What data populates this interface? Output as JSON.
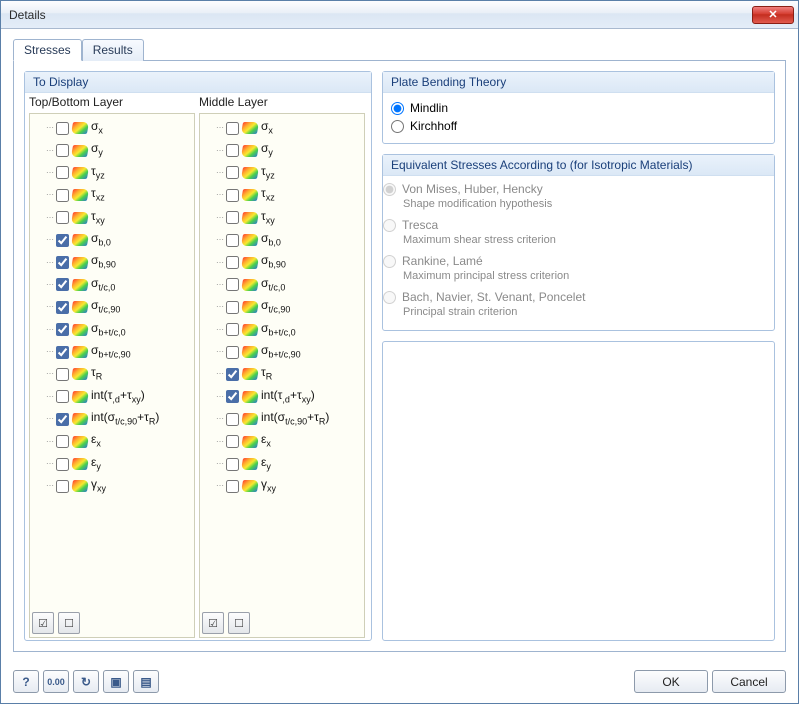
{
  "window": {
    "title": "Details"
  },
  "tabs": {
    "stresses": "Stresses",
    "results": "Results",
    "active": "stresses"
  },
  "display": {
    "group_title": "To Display",
    "col1_header": "Top/Bottom Layer",
    "col2_header": "Middle Layer",
    "top_bottom_items": [
      {
        "label": "σ<sub class='sub'>x</sub>",
        "checked": false
      },
      {
        "label": "σ<sub class='sub'>y</sub>",
        "checked": false
      },
      {
        "label": "τ<sub class='sub'>yz</sub>",
        "checked": false
      },
      {
        "label": "τ<sub class='sub'>xz</sub>",
        "checked": false
      },
      {
        "label": "τ<sub class='sub'>xy</sub>",
        "checked": false
      },
      {
        "label": "σ<sub class='sub'>b,0</sub>",
        "checked": true
      },
      {
        "label": "σ<sub class='sub'>b,90</sub>",
        "checked": true
      },
      {
        "label": "σ<sub class='sub'>t/c,0</sub>",
        "checked": true
      },
      {
        "label": "σ<sub class='sub'>t/c,90</sub>",
        "checked": true
      },
      {
        "label": "σ<sub class='sub'>b+t/c,0</sub>",
        "checked": true
      },
      {
        "label": "σ<sub class='sub'>b+t/c,90</sub>",
        "checked": true
      },
      {
        "label": "τ<sub class='sub'>R</sub>",
        "checked": false
      },
      {
        "label": "int(τ<sub class='sub'>,d</sub>+τ<sub class='sub'>xy</sub>)",
        "checked": false
      },
      {
        "label": "int(σ<sub class='sub'>t/c,90</sub>+τ<sub class='sub'>R</sub>)",
        "checked": true
      },
      {
        "label": "ε<sub class='sub'>x</sub>",
        "checked": false
      },
      {
        "label": "ε<sub class='sub'>y</sub>",
        "checked": false
      },
      {
        "label": "γ<sub class='sub'>xy</sub>",
        "checked": false
      }
    ],
    "middle_items": [
      {
        "label": "σ<sub class='sub'>x</sub>",
        "checked": false
      },
      {
        "label": "σ<sub class='sub'>y</sub>",
        "checked": false
      },
      {
        "label": "τ<sub class='sub'>yz</sub>",
        "checked": false
      },
      {
        "label": "τ<sub class='sub'>xz</sub>",
        "checked": false
      },
      {
        "label": "τ<sub class='sub'>xy</sub>",
        "checked": false
      },
      {
        "label": "σ<sub class='sub'>b,0</sub>",
        "checked": false
      },
      {
        "label": "σ<sub class='sub'>b,90</sub>",
        "checked": false
      },
      {
        "label": "σ<sub class='sub'>t/c,0</sub>",
        "checked": false
      },
      {
        "label": "σ<sub class='sub'>t/c,90</sub>",
        "checked": false
      },
      {
        "label": "σ<sub class='sub'>b+t/c,0</sub>",
        "checked": false
      },
      {
        "label": "σ<sub class='sub'>b+t/c,90</sub>",
        "checked": false
      },
      {
        "label": "τ<sub class='sub'>R</sub>",
        "checked": true
      },
      {
        "label": "int(τ<sub class='sub'>,d</sub>+τ<sub class='sub'>xy</sub>)",
        "checked": true
      },
      {
        "label": "int(σ<sub class='sub'>t/c,90</sub>+τ<sub class='sub'>R</sub>)",
        "checked": false
      },
      {
        "label": "ε<sub class='sub'>x</sub>",
        "checked": false
      },
      {
        "label": "ε<sub class='sub'>y</sub>",
        "checked": false
      },
      {
        "label": "γ<sub class='sub'>xy</sub>",
        "checked": false
      }
    ]
  },
  "plate_bending": {
    "group_title": "Plate Bending Theory",
    "options": [
      {
        "label": "Mindlin",
        "checked": true
      },
      {
        "label": "Kirchhoff",
        "checked": false
      }
    ]
  },
  "equiv_stresses": {
    "group_title": "Equivalent Stresses According to (for Isotropic Materials)",
    "options": [
      {
        "label": "Von Mises, Huber, Hencky",
        "sublabel": "Shape modification hypothesis",
        "checked": true
      },
      {
        "label": "Tresca",
        "sublabel": "Maximum shear stress criterion",
        "checked": false
      },
      {
        "label": "Rankine, Lamé",
        "sublabel": "Maximum principal stress criterion",
        "checked": false
      },
      {
        "label": "Bach, Navier, St. Venant, Poncelet",
        "sublabel": "Principal strain criterion",
        "checked": false
      }
    ]
  },
  "footer": {
    "ok": "OK",
    "cancel": "Cancel"
  }
}
